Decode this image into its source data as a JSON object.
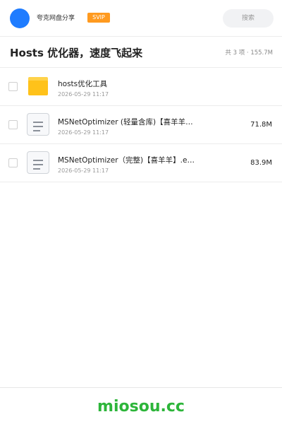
{
  "header": {
    "user_name": "夸克网盘分享",
    "badge": "SVIP",
    "search_placeholder": "搜索"
  },
  "share": {
    "title": "Hosts 优化器，速度飞起来",
    "summary": "共 3 项 · 155.7M"
  },
  "files": [
    {
      "name": "hosts优化工具",
      "date": "2026-05-29 11:17",
      "size": "",
      "icon": "folder-icon"
    },
    {
      "name": "MSNetOptimizer (轻量含库)【喜羊羊…",
      "date": "2026-05-29 11:17",
      "size": "71.8M",
      "icon": "document-icon"
    },
    {
      "name": "MSNetOptimizer（完整)【喜羊羊】.e…",
      "date": "2026-05-29 11:17",
      "size": "83.9M",
      "icon": "document-icon"
    }
  ],
  "footer": {
    "brand": "miosou.cc"
  },
  "colors": {
    "avatar": "#1f7cff",
    "badge": "#ff9a1f",
    "folder": "#ffc21a",
    "brand": "#2db53a"
  }
}
